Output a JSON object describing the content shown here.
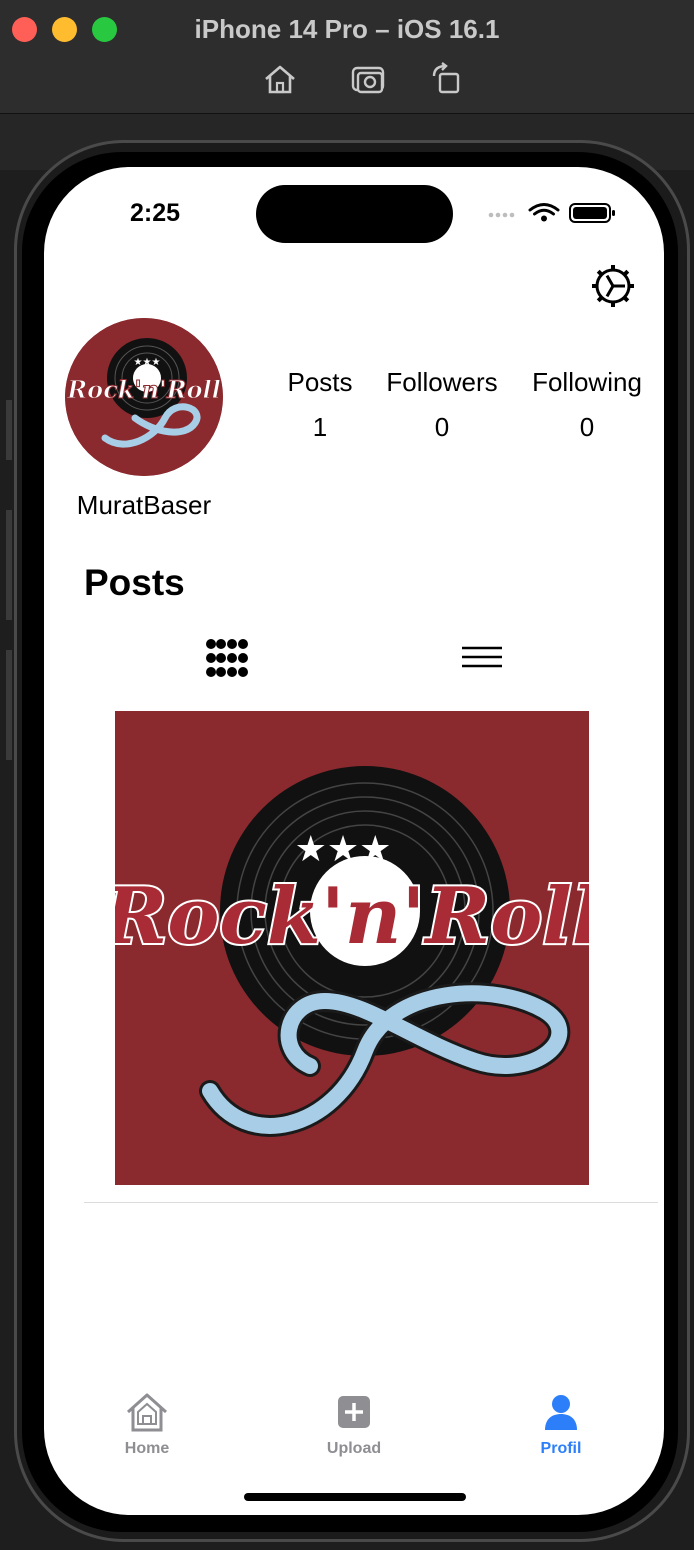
{
  "simulator": {
    "title": "iPhone 14 Pro – iOS 16.1",
    "toolbar": [
      "home-icon",
      "screenshot-icon",
      "rotate-icon"
    ]
  },
  "status_bar": {
    "time": "2:25"
  },
  "profile": {
    "username": "MuratBaser",
    "avatar_text": "Rock'n'Roll",
    "stats": {
      "posts_label": "Posts",
      "posts_value": "1",
      "followers_label": "Followers",
      "followers_value": "0",
      "following_label": "Following",
      "following_value": "0"
    }
  },
  "posts_section": {
    "title": "Posts",
    "post_image_text": "Rock'n'Roll"
  },
  "tabbar": {
    "home_label": "Home",
    "upload_label": "Upload",
    "profil_label": "Profil",
    "active": "Profil"
  },
  "colors": {
    "accent": "#2d7ff9",
    "post_background": "#8b2a2e",
    "ribbon": "#a8cde6",
    "inactive_tab": "#8e8e93"
  }
}
